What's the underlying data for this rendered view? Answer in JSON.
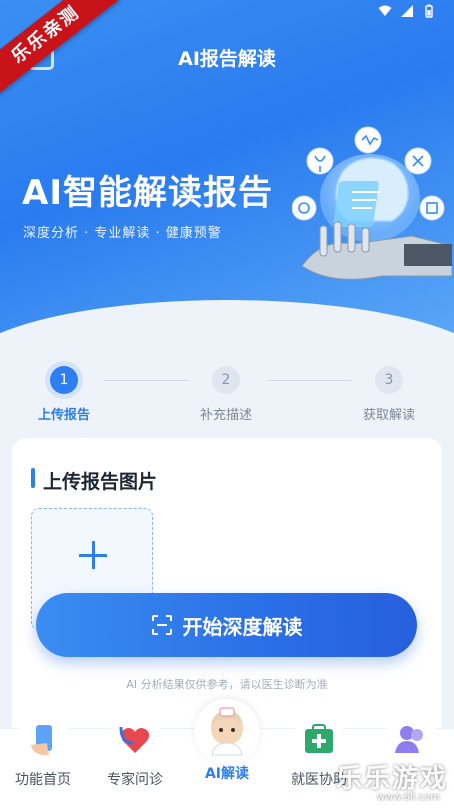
{
  "watermark": {
    "ribbon_text": "乐乐亲测",
    "site_name": "乐乐游戏",
    "site_url": "www.6ll.com"
  },
  "header": {
    "title": "AI报告解读"
  },
  "hero": {
    "title": "AI智能解读报告",
    "subtitle": "深度分析 · 专业解读 · 健康预警"
  },
  "steps": [
    {
      "number": "1",
      "label": "上传报告",
      "active": true
    },
    {
      "number": "2",
      "label": "补充描述",
      "active": false
    },
    {
      "number": "3",
      "label": "获取解读",
      "active": false
    }
  ],
  "upload_card": {
    "title": "上传报告图片"
  },
  "action": {
    "start_label": "开始深度解读"
  },
  "disclaimer": "AI 分析结果仅供参考，请以医生诊断为准",
  "tabbar": {
    "tabs": [
      {
        "label": "功能首页",
        "icon": "phone-hand-icon",
        "active": false
      },
      {
        "label": "专家问诊",
        "icon": "stethoscope-heart-icon",
        "active": false
      },
      {
        "label": "AI解读",
        "icon": "nurse-avatar-icon",
        "active": true
      },
      {
        "label": "就医协助",
        "icon": "medical-kit-icon",
        "active": false
      },
      {
        "label": "",
        "icon": "user-group-icon",
        "active": false
      }
    ]
  },
  "colors": {
    "primary": "#2d7ff0",
    "hero_top": "#3a8ff3",
    "page_bg": "#eef3f9"
  }
}
